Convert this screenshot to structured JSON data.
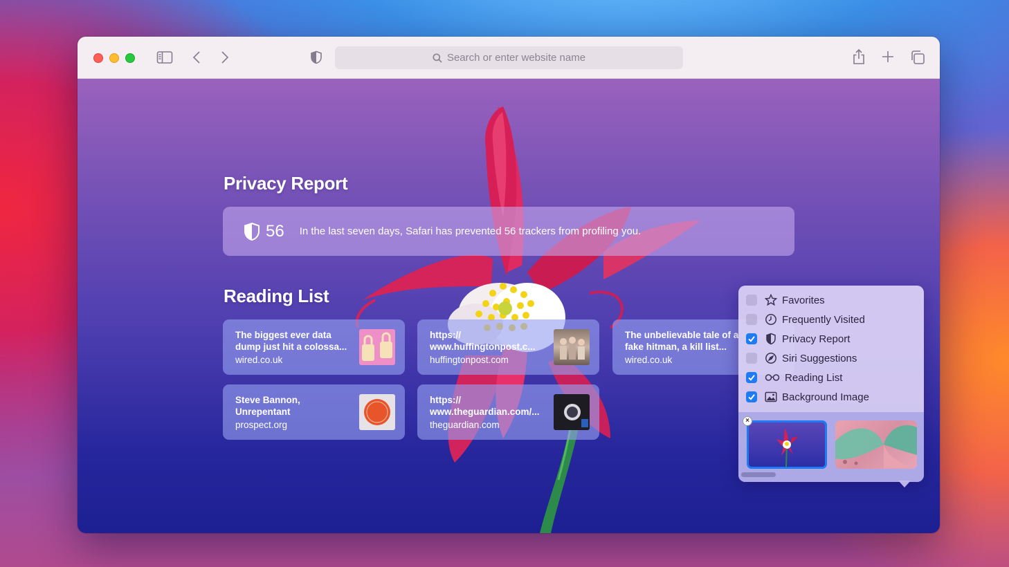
{
  "toolbar": {
    "address_placeholder": "Search or enter website name"
  },
  "privacy": {
    "title": "Privacy Report",
    "count": "56",
    "message": "In the last seven days, Safari has prevented 56 trackers from profiling you."
  },
  "reading_list": {
    "title": "Reading List",
    "items": [
      {
        "title": "The biggest ever data dump just hit a colossa...",
        "domain": "wired.co.uk"
      },
      {
        "title": "https:// www.huffingtonpost.c...",
        "domain": "huffingtonpost.com"
      },
      {
        "title": "The unbelievable tale of a fake hitman, a kill list...",
        "domain": "wired.co.uk"
      },
      {
        "title": "Steve Bannon, Unrepentant",
        "domain": "prospect.org"
      },
      {
        "title": "https:// www.theguardian.com/...",
        "domain": "theguardian.com"
      }
    ]
  },
  "customize": {
    "items": [
      {
        "label": "Favorites",
        "checked": false,
        "icon": "star-icon"
      },
      {
        "label": "Frequently Visited",
        "checked": false,
        "icon": "clock-icon"
      },
      {
        "label": "Privacy Report",
        "checked": true,
        "icon": "shield-icon"
      },
      {
        "label": "Siri Suggestions",
        "checked": false,
        "icon": "compass-icon"
      },
      {
        "label": "Reading List",
        "checked": true,
        "icon": "glasses-icon"
      },
      {
        "label": "Background Image",
        "checked": true,
        "icon": "image-icon"
      }
    ]
  },
  "colors": {
    "accent": "#1f7bf2",
    "toolbar_bg": "#f4eef2"
  }
}
